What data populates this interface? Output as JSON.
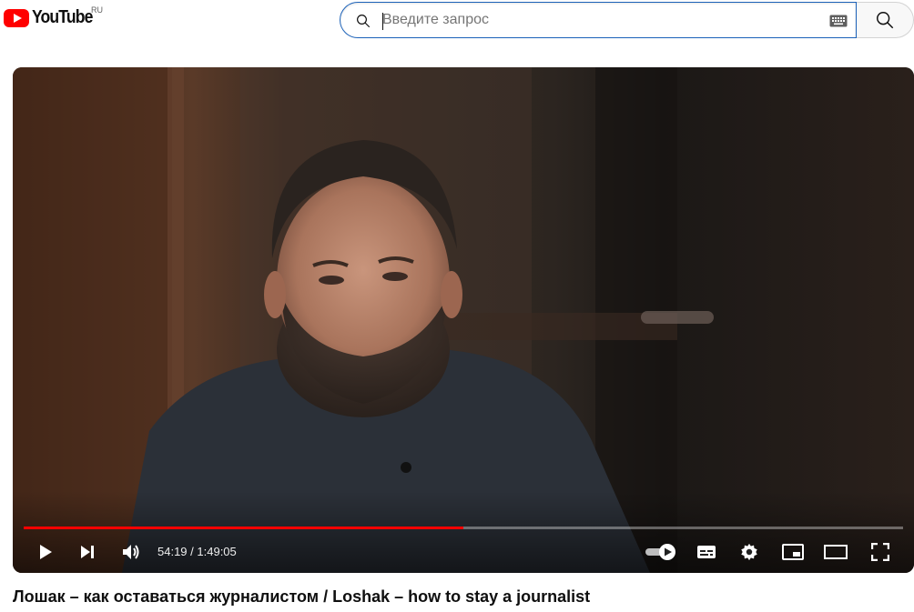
{
  "header": {
    "logo_text": "YouTube",
    "region": "RU",
    "search": {
      "placeholder": "Введите запрос",
      "value": ""
    }
  },
  "player": {
    "current_time": "54:19",
    "separator": " / ",
    "duration": "1:49:05",
    "progress_fraction": 0.5,
    "autoplay": "on",
    "icons": [
      "play-icon",
      "next-icon",
      "volume-icon",
      "autoplay-toggle-icon",
      "subtitles-icon",
      "settings-icon",
      "miniplayer-icon",
      "theater-mode-icon",
      "fullscreen-icon"
    ]
  },
  "video": {
    "title": "Лошак – как оставаться журналистом / Loshak – how to stay a journalist"
  },
  "colors": {
    "accent": "#ff0000",
    "search_border": "#1c62b9",
    "text": "#0f0f0f"
  }
}
